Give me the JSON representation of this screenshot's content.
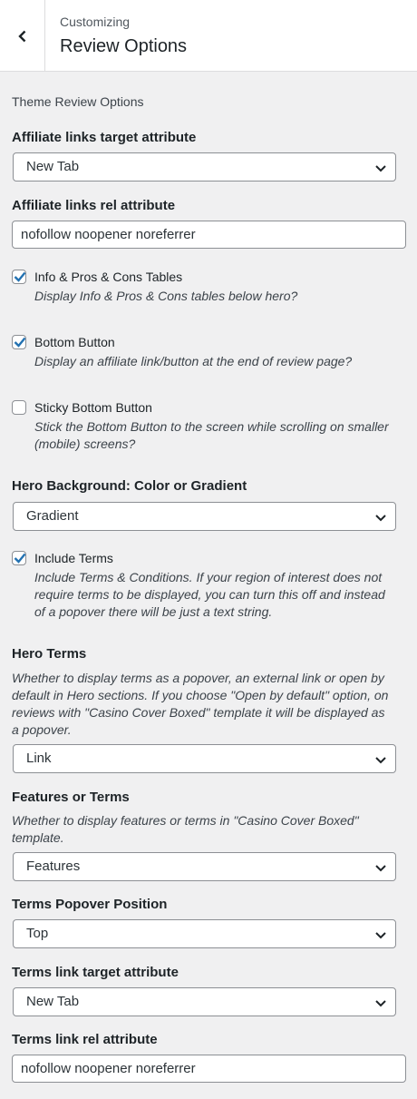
{
  "header": {
    "subtitle": "Customizing",
    "title": "Review Options"
  },
  "section_title": "Theme Review Options",
  "affiliate_target": {
    "label": "Affiliate links target attribute",
    "value": "New Tab"
  },
  "affiliate_rel": {
    "label": "Affiliate links rel attribute",
    "value": "nofollow noopener noreferrer"
  },
  "info_tables": {
    "label": "Info & Pros & Cons Tables",
    "desc": "Display Info & Pros & Cons tables below hero?",
    "checked": true
  },
  "bottom_button": {
    "label": "Bottom Button",
    "desc": "Display an affiliate link/button at the end of review page?",
    "checked": true
  },
  "sticky_button": {
    "label": "Sticky Bottom Button",
    "desc_line1": "Stick the Bottom Button to the screen while scrolling on smaller",
    "desc_line2": "(mobile) screens?",
    "checked": false
  },
  "hero_background": {
    "label": "Hero Background: Color or Gradient",
    "value": "Gradient"
  },
  "include_terms": {
    "label": "Include Terms",
    "desc_line1": "Include Terms & Conditions. If your region of interest does not",
    "desc_line2": "require terms to be displayed, you can turn this off and instead",
    "desc_line3": "of a popover there will be just a text string.",
    "checked": true
  },
  "hero_terms": {
    "label": "Hero Terms",
    "desc_line1": "Whether to display terms as a popover, an external link or open by",
    "desc_line2": "default in Hero sections. If you choose \"Open by default\" option, on",
    "desc_line3": "reviews with \"Casino Cover Boxed\" template it will be displayed as",
    "desc_line4": "a popover.",
    "value": "Link"
  },
  "features_terms": {
    "label": "Features or Terms",
    "desc_line1": "Whether to display features or terms in \"Casino Cover Boxed\"",
    "desc_line2": "template.",
    "value": "Features"
  },
  "popover_position": {
    "label": "Terms Popover Position",
    "value": "Top"
  },
  "terms_target": {
    "label": "Terms link target attribute",
    "value": "New Tab"
  },
  "terms_rel": {
    "label": "Terms link rel attribute",
    "value": "nofollow noopener noreferrer"
  },
  "colors": {
    "accent": "#2271b1",
    "background": "#f0f0f1"
  }
}
